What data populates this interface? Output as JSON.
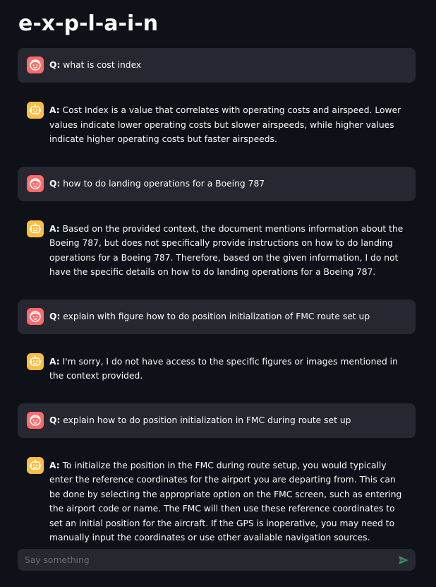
{
  "app": {
    "title": "e-x-p-l-a-i-n"
  },
  "messages": [
    {
      "role": "user",
      "prefix": "Q:",
      "text": "what is cost index"
    },
    {
      "role": "assistant",
      "prefix": "A:",
      "text": "Cost Index is a value that correlates with operating costs and airspeed. Lower values indicate lower operating costs but slower airspeeds, while higher values indicate higher operating costs but faster airspeeds."
    },
    {
      "role": "user",
      "prefix": "Q:",
      "text": "how to do landing operations for a Boeing 787"
    },
    {
      "role": "assistant",
      "prefix": "A:",
      "text": "Based on the provided context, the document mentions information about the Boeing 787, but does not specifically provide instructions on how to do landing operations for a Boeing 787. Therefore, based on the given information, I do not have the specific details on how to do landing operations for a Boeing 787."
    },
    {
      "role": "user",
      "prefix": "Q:",
      "text": "explain with figure how to do position initialization of FMC route set up"
    },
    {
      "role": "assistant",
      "prefix": "A:",
      "text": "I'm sorry, I do not have access to the specific figures or images mentioned in the context provided."
    },
    {
      "role": "user",
      "prefix": "Q:",
      "text": "explain how to do position initialization in FMC during route set up"
    },
    {
      "role": "assistant",
      "prefix": "A:",
      "text": "To initialize the position in the FMC during route setup, you would typically enter the reference coordinates for the airport you are departing from. This can be done by selecting the appropriate option on the FMC screen, such as entering the airport code or name. The FMC will then use these reference coordinates to set an initial position for the aircraft. If the GPS is inoperative, you may need to manually input the coordinates or use other available navigation sources."
    }
  ],
  "chat_input": {
    "placeholder": "Say something"
  },
  "icons": {
    "user_avatar": "user-face-icon",
    "assistant_avatar": "robot-face-icon",
    "send": "send-icon"
  },
  "colors": {
    "background": "#0e1117",
    "user_bubble": "#262730",
    "user_avatar": "#ff6b6b",
    "assistant_avatar": "#ffbd45",
    "send_icon": "#3b8e5a"
  }
}
